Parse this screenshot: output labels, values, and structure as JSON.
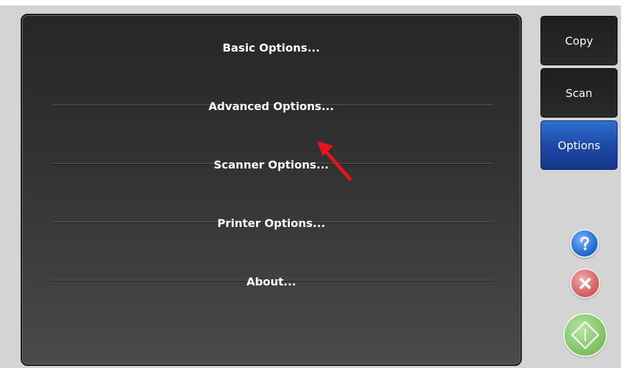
{
  "menu": {
    "items": [
      {
        "label": "Basic Options..."
      },
      {
        "label": "Advanced Options..."
      },
      {
        "label": "Scanner Options..."
      },
      {
        "label": "Printer Options..."
      },
      {
        "label": "About..."
      }
    ]
  },
  "side_nav": {
    "copy_label": "Copy",
    "scan_label": "Scan",
    "options_label": "Options",
    "active": "Options"
  },
  "icons": {
    "help": "help-icon",
    "cancel": "cancel-icon",
    "start": "start-icon",
    "annotation": "red-arrow-annotation"
  },
  "colors": {
    "panel_background": "#333333",
    "active_tab": "#1d4aa8",
    "annotation_arrow": "#e8141a",
    "help_blue": "#2c73d6",
    "cancel_red": "#d66a6a",
    "start_green": "#87c96d"
  }
}
